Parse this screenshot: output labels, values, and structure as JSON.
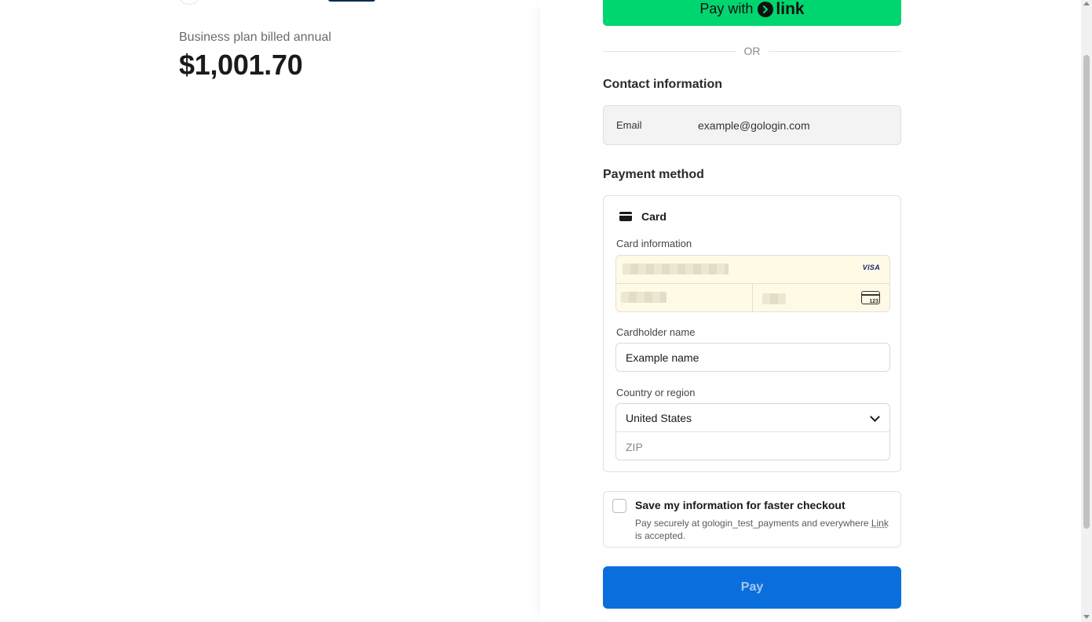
{
  "summary": {
    "plan_label": "Business plan billed annual",
    "price": "$1,001.70"
  },
  "express": {
    "pay_with_label": "Pay with",
    "link_brand": "link",
    "or_label": "OR"
  },
  "contact": {
    "title": "Contact information",
    "email_label": "Email",
    "email_value": "example@gologin.com"
  },
  "payment": {
    "title": "Payment method",
    "method_label": "Card",
    "card_info_label": "Card information",
    "card_brand": "VISA",
    "cvc_icon_text": "123",
    "cardholder_label": "Cardholder name",
    "cardholder_value": "Example name",
    "country_label": "Country or region",
    "country_value": "United States",
    "zip_placeholder": "ZIP"
  },
  "save_info": {
    "title": "Save my information for faster checkout",
    "desc_before": "Pay securely at gologin_test_payments and everywhere ",
    "desc_link": "Link",
    "desc_after": " is accepted.",
    "checked": false
  },
  "pay_button": {
    "label": "Pay"
  },
  "colors": {
    "link_green": "#00d66f",
    "pay_blue": "#0a6fdc",
    "autofill_yellow": "#fefae5"
  }
}
